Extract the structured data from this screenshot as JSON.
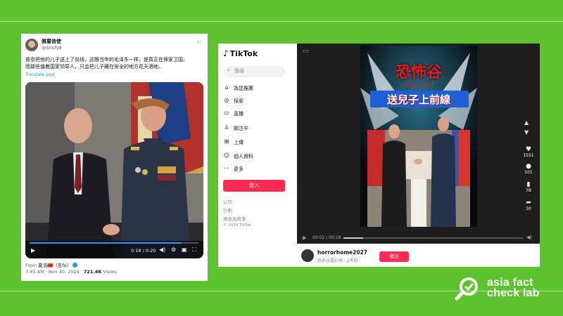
{
  "tweet": {
    "author_name": "雅童信使",
    "handle": "@Snofy8",
    "text_line1": "普京把他的儿子送上了前线，这跟当年的毛泽东一样，是真正在保家卫国。",
    "text_line2": "而那些僵着国家领导人，只会把儿子藏在安全的地方花天酒地。",
    "translate": "Translate post",
    "video_time": "0:18 / 0:20",
    "from_label": "From",
    "from_name": "夏浩🇨🇳（互fo）",
    "meta_time": "7:45 AM · Nov 30, 2024 ·",
    "views": "721.4K",
    "views_label": "Views"
  },
  "tiktok": {
    "brand": "TikTok",
    "search_placeholder": "搜尋",
    "nav": [
      {
        "icon": "home-icon",
        "glyph": "⌂",
        "label": "為您推薦"
      },
      {
        "icon": "compass-icon",
        "glyph": "◎",
        "label": "探索"
      },
      {
        "icon": "live-icon",
        "glyph": "▭",
        "label": "直播"
      },
      {
        "icon": "following-icon",
        "glyph": "♙",
        "label": "關注中"
      },
      {
        "icon": "upload-icon",
        "glyph": "⊞",
        "label": "上傳"
      },
      {
        "icon": "profile-icon",
        "glyph": "☺",
        "label": "個人資料"
      },
      {
        "icon": "more-icon",
        "glyph": "⋯",
        "label": "更多"
      }
    ],
    "login": "登入",
    "footer": [
      "公司",
      "計劃",
      "條款與政策"
    ],
    "copyright": "© 2024 TikTok",
    "video_title": "恐怖谷",
    "video_subtitle": "Happy 2027",
    "video_caption": "送兒子上前線",
    "likes": "1551",
    "comments": "101",
    "saves": "78",
    "shares": "30",
    "progress": "00:02 / 00:18",
    "progress_fraction": 0.11,
    "username": "horrorhome2027",
    "user_sub": "恐怖谷電幻境 · 2天前",
    "follow": "關注"
  },
  "brand": {
    "line1": "asia fact",
    "line2": "check lab"
  },
  "colors": {
    "background": "#5cc32e",
    "tiktok_red": "#fe2c55",
    "x_blue": "#1d9bf0"
  }
}
